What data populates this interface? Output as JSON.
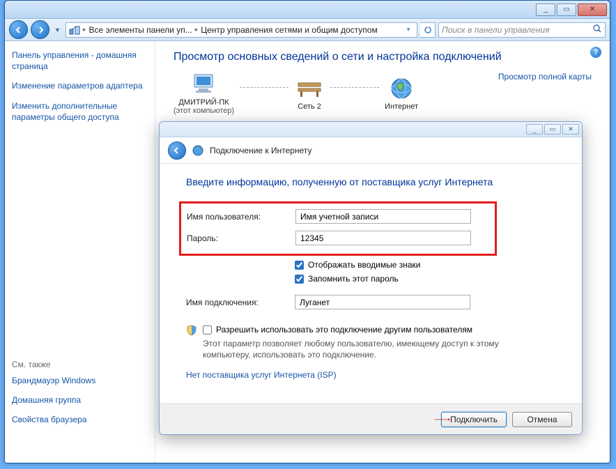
{
  "titlebar": {
    "min_label": "_",
    "max_label": "▭",
    "close_label": "✕"
  },
  "toolbar": {
    "crumb1": "Все элементы панели уп...",
    "crumb2": "Центр управления сетями и общим доступом",
    "search_placeholder": "Поиск в панели управления"
  },
  "sidebar": {
    "home": "Панель управления - домашняя страница",
    "link1": "Изменение параметров адаптера",
    "link2": "Изменить дополнительные параметры общего доступа",
    "see_also": "См. также",
    "link3": "Брандмауэр Windows",
    "link4": "Домашняя группа",
    "link5": "Свойства браузера"
  },
  "main": {
    "heading": "Просмотр основных сведений о сети и настройка подключений",
    "map_link": "Просмотр полной карты",
    "node1": "ДМИТРИЙ-ПК",
    "node1_sub": "(этот компьютер)",
    "node2": "Сеть 2",
    "node3": "Интернет"
  },
  "dialog": {
    "title": "Подключение к Интернету",
    "heading": "Введите информацию, полученную от поставщика услуг Интернета",
    "username_lbl": "Имя пользователя:",
    "username_val": "Имя учетной записи",
    "password_lbl": "Пароль:",
    "password_val": "12345",
    "show_chars": "Отображать вводимые знаки",
    "remember": "Запомнить этот пароль",
    "conn_name_lbl": "Имя подключения:",
    "conn_name_val": "Луганет",
    "allow_others": "Разрешить использовать это подключение другим пользователям",
    "allow_others_sub": "Этот параметр позволяет любому пользователю, имеющему доступ к этому компьютеру, использовать это подключение.",
    "isp_link": "Нет поставщика услуг Интернета (ISP)",
    "connect": "Подключить",
    "cancel": "Отмена"
  }
}
